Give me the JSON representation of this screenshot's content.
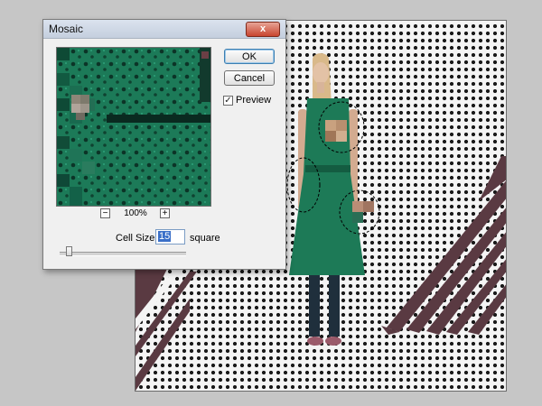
{
  "dialog": {
    "title": "Mosaic",
    "close_label": "x",
    "ok_label": "OK",
    "cancel_label": "Cancel",
    "preview_label": "Preview",
    "preview_checked": true,
    "zoom_out_label": "−",
    "zoom_in_label": "+",
    "zoom_level": "100%",
    "cell_size_label": "Cell Size:",
    "cell_size_value": "15",
    "cell_size_unit": "square",
    "cell_size_slider_fraction": 0.05
  },
  "colors": {
    "dress_green": "#1d7a57",
    "stripe_color": "#5a3a42",
    "dot_color": "#1a1a1a",
    "canvas_bg": "#f4f4f4"
  },
  "icons": {
    "checkbox": "check-mark-icon"
  }
}
